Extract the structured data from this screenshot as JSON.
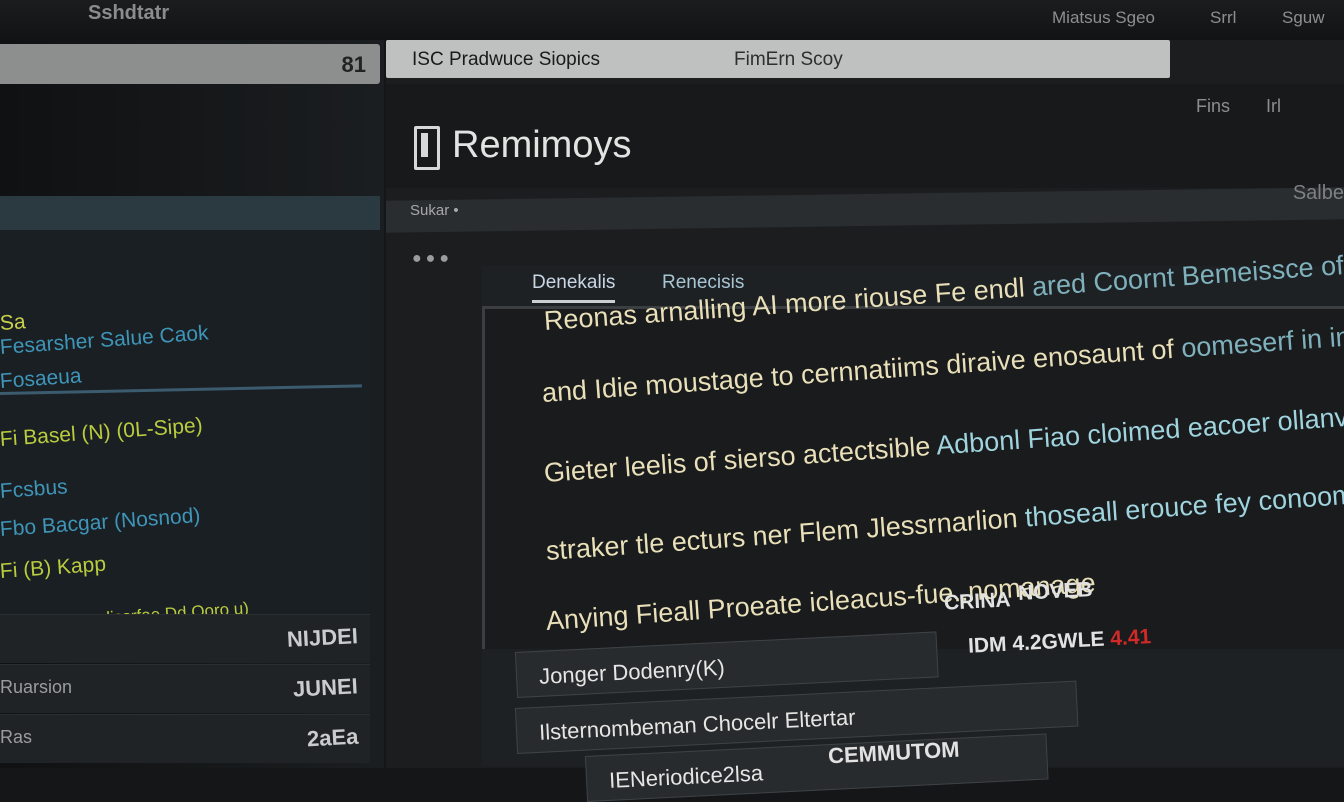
{
  "app": {
    "name": "Sshdtatr"
  },
  "topbar": {
    "menu": [
      "Miatsus Sgeo",
      "Srrl",
      "Sguw"
    ]
  },
  "sidebar": {
    "search_icon_text": "81",
    "items": [
      {
        "label": "Sa",
        "color": "#c8d04a"
      },
      {
        "label": "Fesarsher Salue Caok",
        "color": "#3e95b8"
      },
      {
        "label": "Fosaeua",
        "color": "#3e95b8"
      },
      {
        "label": "Fi Basel (N) (0L-Sipe)",
        "color": "#b9cc3d"
      },
      {
        "label": "Fcsbus",
        "color": "#3e95b8"
      },
      {
        "label": "Fbo Bacgar (Nosnod)",
        "color": "#3e95b8"
      },
      {
        "label": "Fi (B) Kapp",
        "color": "#b9cc3d"
      },
      {
        "label": "Focsadepsn elissrfae Dd Ooro u)",
        "color": "#b9cc3d"
      }
    ],
    "rows": [
      {
        "left": "",
        "right": "NIJDEI"
      },
      {
        "left": "Ruarsion",
        "right": "JUNEI"
      },
      {
        "left": "Ras",
        "right": "2aEa"
      }
    ]
  },
  "main": {
    "title_bar": {
      "left": "ISC Pradwuce Siopics",
      "right": "FimErn Scoy"
    },
    "controls": [
      "Fins",
      "Irl"
    ],
    "page_title": "Remimoys",
    "breadcrumb": "Sukar •",
    "header_right": "Salbe",
    "tabs": [
      "Denekalis",
      "Renecisis"
    ],
    "body": {
      "lines": [
        {
          "warm": "Reonas arnalling AI more riouse Fe endl",
          "cool": "ared Coornt Bemeissce of mnandoss"
        },
        {
          "warm": "and Idie moustage to cernnatiims diraive enosaunt of",
          "cool": "oomeserf in in Sgome"
        },
        {
          "warm": "Gieter leelis of sierso actectsible",
          "cool": "Adbonl Fiao cloimed eacoer ollanvsbonatime"
        },
        {
          "warm": "straker tle ecturs ner Flem Jlessrnarlion",
          "cool": "thoseall erouce fey conoomovaoas"
        },
        {
          "warm": "Anying Fieall Proeate icleacus-fue..nomanage",
          "cool": ""
        }
      ]
    },
    "status_top": [
      "CRINA",
      "NOVEB"
    ],
    "status_bottom": {
      "text": "IDM 4.2GWLE",
      "flag": "4.41"
    },
    "list": [
      "Jonger Dodenry(K)",
      "Ilsternombeman Chocelr Eltertar",
      "IENeriodice2lsa"
    ],
    "list_extra": "CEMMUTOM"
  }
}
